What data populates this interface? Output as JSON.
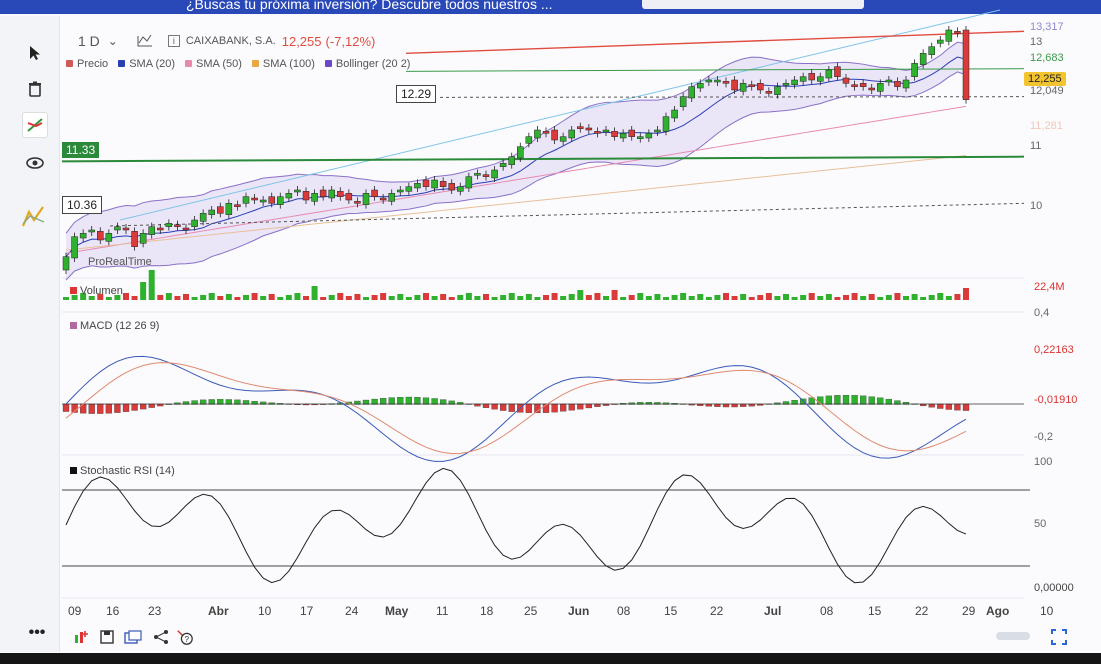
{
  "banner": {
    "text": "¿Buscas tu próxima inversión? Descubre todos nuestros ..."
  },
  "toolbar": {
    "timeframe": "1 D",
    "caret": "⌄",
    "instrument": "CAIXABANK, S.A.",
    "price": "12,255",
    "change": "(-7,12%)"
  },
  "legend": [
    {
      "label": "Precio",
      "color": "#d05a5a"
    },
    {
      "label": "SMA (20)",
      "color": "#2b3fb5"
    },
    {
      "label": "SMA (50)",
      "color": "#e88ab0"
    },
    {
      "label": "SMA (100)",
      "color": "#e8a844"
    },
    {
      "label": "Bollinger (20 2)",
      "color": "#6b48c8"
    }
  ],
  "overlay_labels": {
    "level_1229": "12.29",
    "level_1133": "11.33",
    "level_1036": "10.36",
    "watermark": "ProRealTime"
  },
  "right_axis": {
    "price_ticks": [
      "13,317",
      "13",
      "12,683",
      "12,049",
      "11",
      "10"
    ],
    "current_price_tag": "12,255",
    "faint_tag": "11,281",
    "volume_tag": "22,4M",
    "macd_ticks": [
      "0,4",
      "-0,2"
    ],
    "macd_tag": "0,22163",
    "macd_hist_tag": "-0,01910",
    "stoch_ticks": [
      "100",
      "50"
    ],
    "stoch_tag": "0,00000"
  },
  "panels": {
    "volume": "Volumen",
    "macd": "MACD (12 26 9)",
    "stoch": "Stochastic RSI (14)"
  },
  "x_axis": [
    "09",
    "16",
    "23",
    "Abr",
    "10",
    "17",
    "24",
    "May",
    "11",
    "18",
    "25",
    "Jun",
    "08",
    "15",
    "22",
    "Jul",
    "08",
    "15",
    "22",
    "29",
    "Ago",
    "10"
  ],
  "colors": {
    "up": "#2fb12f",
    "down": "#d93a3a",
    "bollinger_fill": "#e6e0f5",
    "accent_red": "#e04d40"
  },
  "chart_data": {
    "type": "candlestick",
    "title": "CAIXABANK, S.A.",
    "ylabel": "",
    "ylim": [
      9.7,
      13.45
    ],
    "closes": [
      9.9,
      10.2,
      10.25,
      10.3,
      10.15,
      10.25,
      10.35,
      10.3,
      10.05,
      10.25,
      10.35,
      10.3,
      10.4,
      10.35,
      10.3,
      10.45,
      10.55,
      10.6,
      10.55,
      10.7,
      10.65,
      10.8,
      10.75,
      10.75,
      10.7,
      10.8,
      10.85,
      10.9,
      10.75,
      10.85,
      10.8,
      10.9,
      10.8,
      10.75,
      10.7,
      10.85,
      10.8,
      10.75,
      10.85,
      10.9,
      10.95,
      11.0,
      10.95,
      11.05,
      10.95,
      10.9,
      10.95,
      11.1,
      11.15,
      11.1,
      11.2,
      11.3,
      11.4,
      11.55,
      11.7,
      11.8,
      11.75,
      11.65,
      11.7,
      11.8,
      11.85,
      11.8,
      11.75,
      11.8,
      11.7,
      11.75,
      11.7,
      11.7,
      11.75,
      11.8,
      12.0,
      12.1,
      12.3,
      12.45,
      12.5,
      12.55,
      12.55,
      12.5,
      12.4,
      12.5,
      12.45,
      12.4,
      12.35,
      12.45,
      12.5,
      12.55,
      12.6,
      12.55,
      12.6,
      12.7,
      12.6,
      12.5,
      12.45,
      12.45,
      12.4,
      12.5,
      12.55,
      12.45,
      12.55,
      12.8,
      12.95,
      13.05,
      13.15,
      13.3,
      13.25,
      12.255
    ],
    "volume_hint": "bars below price",
    "macd_ticks": [
      0.4,
      -0.2
    ],
    "stoch_range": [
      0,
      100
    ]
  }
}
